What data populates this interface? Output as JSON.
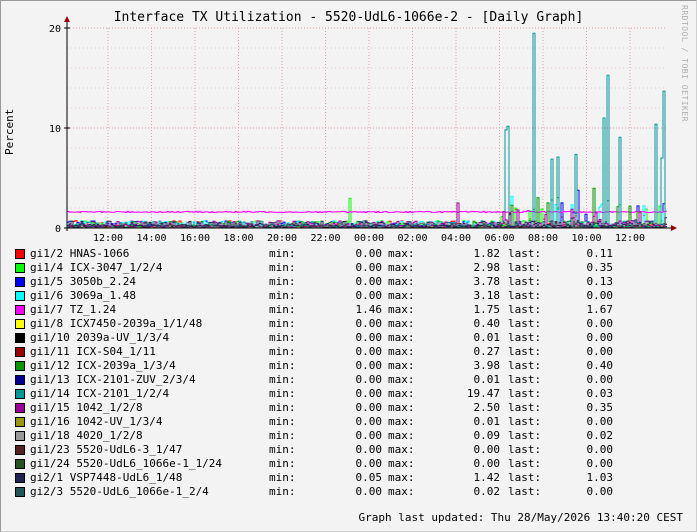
{
  "title": "Interface TX Utilization - 5520-UdL6-1066e-2 - [Daily Graph]",
  "watermark": "RRDTOOL / TOBI OETIKER",
  "footer": "Graph last updated: Thu 28/May/2026 13:40:20 CEST",
  "legend_labels": {
    "min": "min:",
    "max": "max:",
    "last": "last:"
  },
  "chart_data": {
    "type": "line",
    "ylabel": "Percent",
    "ylim": [
      0,
      20
    ],
    "yticks": [
      0,
      10,
      20
    ],
    "xticks": [
      "12:00",
      "14:00",
      "16:00",
      "18:00",
      "20:00",
      "22:00",
      "00:00",
      "02:00",
      "04:00",
      "06:00",
      "08:00",
      "10:00",
      "12:00"
    ],
    "grid": true,
    "legend_position": "bottom",
    "series": [
      {
        "name": "gi1/2 HNAS-1066",
        "color": "#ff0000",
        "min": "0.00",
        "max": "1.82",
        "last": "0.11"
      },
      {
        "name": "gi1/4 ICX-3047_1/2/4",
        "color": "#00ff00",
        "min": "0.00",
        "max": "2.98",
        "last": "0.35"
      },
      {
        "name": "gi1/5 3050b_2.24",
        "color": "#0000ff",
        "min": "0.00",
        "max": "3.78",
        "last": "0.13"
      },
      {
        "name": "gi1/6 3069a_1.48",
        "color": "#00ffff",
        "min": "0.00",
        "max": "3.18",
        "last": "0.00"
      },
      {
        "name": "gi1/7 TZ_1.24",
        "color": "#ff00ff",
        "min": "1.46",
        "max": "1.75",
        "last": "1.67"
      },
      {
        "name": "gi1/8 ICX7450-2039a_1/1/48",
        "color": "#ffff00",
        "min": "0.00",
        "max": "0.40",
        "last": "0.00"
      },
      {
        "name": "gi1/10 2039a-UV_1/3/4",
        "color": "#000000",
        "min": "0.00",
        "max": "0.01",
        "last": "0.00"
      },
      {
        "name": "gi1/11 ICX-S04_1/11",
        "color": "#990000",
        "min": "0.00",
        "max": "0.27",
        "last": "0.00"
      },
      {
        "name": "gi1/12 ICX-2039a_1/3/4",
        "color": "#009900",
        "min": "0.00",
        "max": "3.98",
        "last": "0.40"
      },
      {
        "name": "gi1/13 ICX-2101-ZUV_2/3/4",
        "color": "#000099",
        "min": "0.00",
        "max": "0.01",
        "last": "0.00"
      },
      {
        "name": "gi1/14 ICX-2101_1/2/4",
        "color": "#009999",
        "min": "0.00",
        "max": "19.47",
        "last": "0.03"
      },
      {
        "name": "gi1/15 1042_1/2/8",
        "color": "#990099",
        "min": "0.00",
        "max": "2.50",
        "last": "0.35"
      },
      {
        "name": "gi1/16 1042-UV_1/3/4",
        "color": "#999900",
        "min": "0.00",
        "max": "0.01",
        "last": "0.00"
      },
      {
        "name": "gi1/18 4020_1/2/8",
        "color": "#999999",
        "min": "0.00",
        "max": "0.09",
        "last": "0.02"
      },
      {
        "name": "gi1/23 5520-UdL6-3_1/47",
        "color": "#552222",
        "min": "0.00",
        "max": "0.00",
        "last": "0.00"
      },
      {
        "name": "gi1/24 5520-UdL6_1066e-1_1/24",
        "color": "#225522",
        "min": "0.00",
        "max": "0.00",
        "last": "0.00"
      },
      {
        "name": "gi2/1 VSP7448-UdL6_1/48",
        "color": "#222255",
        "min": "0.05",
        "max": "1.42",
        "last": "1.03"
      },
      {
        "name": "gi2/3 5520-UdL6_1066e-1_2/4",
        "color": "#225555",
        "min": "0.00",
        "max": "0.02",
        "last": "0.00"
      }
    ]
  }
}
